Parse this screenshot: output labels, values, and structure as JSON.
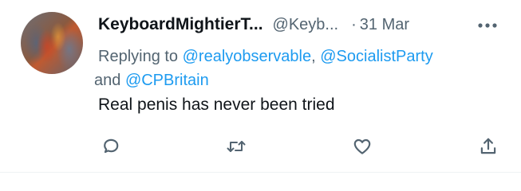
{
  "tweet": {
    "display_name": "KeyboardMightierT...",
    "handle": "@Keyb...",
    "separator": "·",
    "date": "31 Mar",
    "replying_prefix": "Replying to ",
    "mentions": [
      "@realyobservable",
      "@SocialistParty",
      "@CPBritain"
    ],
    "mention_comma": ", ",
    "mention_and": " and ",
    "text": "Real penis has never been tried"
  },
  "icons": {
    "more": "more-horizontal-icon",
    "reply": "reply-bubble-icon",
    "retweet": "retweet-icon",
    "like": "heart-icon",
    "share": "share-upload-icon"
  },
  "colors": {
    "text_primary": "#0f1419",
    "text_secondary": "#536471",
    "link": "#1d9bf0",
    "divider": "#eff3f4"
  }
}
